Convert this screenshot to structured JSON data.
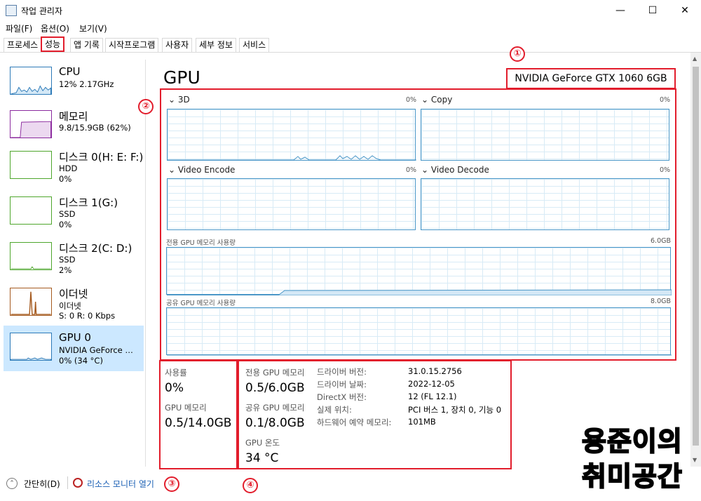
{
  "window": {
    "title": "작업 관리자",
    "minimize": "—",
    "maximize": "☐",
    "close": "✕"
  },
  "menu": [
    "파일(F)",
    "옵션(O)",
    "보기(V)"
  ],
  "tabs": [
    "프로세스",
    "성능",
    "앱 기록",
    "시작프로그램",
    "사용자",
    "세부 정보",
    "서비스"
  ],
  "annotations": [
    "①",
    "②",
    "③",
    "④"
  ],
  "sidebar": [
    {
      "name": "CPU",
      "l2": "12% 2.17GHz",
      "l3": ""
    },
    {
      "name": "메모리",
      "l2": "9.8/15.9GB (62%)",
      "l3": ""
    },
    {
      "name": "디스크 0(H: E: F:)",
      "l2": "HDD",
      "l3": "0%"
    },
    {
      "name": "디스크 1(G:)",
      "l2": "SSD",
      "l3": "0%"
    },
    {
      "name": "디스크 2(C: D:)",
      "l2": "SSD",
      "l3": "2%"
    },
    {
      "name": "이더넷",
      "l2": "이더넷",
      "l3": "S: 0 R: 0 Kbps"
    },
    {
      "name": "GPU 0",
      "l2": "NVIDIA GeForce …",
      "l3": "0% (34 °C)"
    }
  ],
  "gpu": {
    "title": "GPU",
    "model": "NVIDIA GeForce GTX 1060 6GB",
    "engines": [
      {
        "label": "3D",
        "pct": "0%"
      },
      {
        "label": "Copy",
        "pct": "0%"
      },
      {
        "label": "Video Encode",
        "pct": "0%"
      },
      {
        "label": "Video Decode",
        "pct": "0%"
      }
    ],
    "dedicated_label": "전용 GPU 메모리 사용량",
    "dedicated_max": "6.0GB",
    "shared_label": "공유 GPU 메모리 사용량",
    "shared_max": "8.0GB"
  },
  "stats": {
    "usage_label": "사용률",
    "usage": "0%",
    "gpumem_label": "GPU 메모리",
    "gpumem": "0.5/14.0GB",
    "ded_label": "전용 GPU 메모리",
    "ded": "0.5/6.0GB",
    "shr_label": "공유 GPU 메모리",
    "shr": "0.1/8.0GB",
    "temp_label": "GPU 온도",
    "temp": "34 °C"
  },
  "details": [
    {
      "k": "드라이버 버전:",
      "v": "31.0.15.2756"
    },
    {
      "k": "드라이버 날짜:",
      "v": "2022-12-05"
    },
    {
      "k": "DirectX 버전:",
      "v": "12 (FL 12.1)"
    },
    {
      "k": "실제 위치:",
      "v": "PCI 버스 1, 장치 0, 기능 0"
    },
    {
      "k": "하드웨어 예약 메모리:",
      "v": "101MB"
    }
  ],
  "bottom": {
    "collapse": "간단히(D)",
    "monitor": "리소스 모니터 열기"
  },
  "watermark": [
    "용준이의",
    "취미공간"
  ],
  "colors": {
    "accent_red": "#e21d2c",
    "graph_blue": "#4a97c8",
    "selected_bg": "#cce8ff",
    "link": "#1a5fb4"
  }
}
